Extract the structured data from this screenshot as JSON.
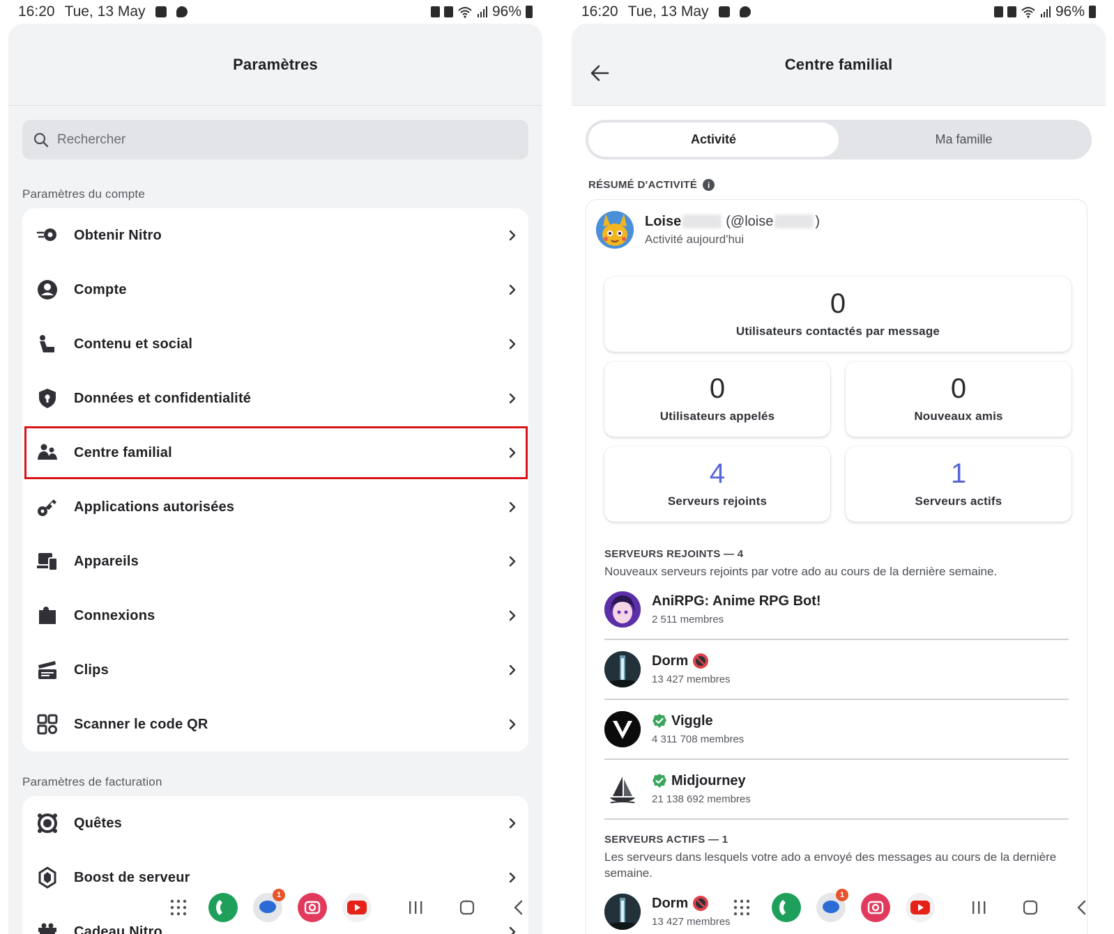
{
  "status_bar": {
    "time": "16:20",
    "date": "Tue, 13 May",
    "battery": "96%"
  },
  "left": {
    "title": "Paramètres",
    "search_placeholder": "Rechercher",
    "account_section_title": "Paramètres du compte",
    "account_items": [
      {
        "label": "Obtenir Nitro",
        "icon": "nitro-icon"
      },
      {
        "label": "Compte",
        "icon": "account-icon"
      },
      {
        "label": "Contenu et social",
        "icon": "content-social-icon"
      },
      {
        "label": "Données et confidentialité",
        "icon": "shield-icon"
      },
      {
        "label": "Centre familial",
        "icon": "family-icon",
        "highlighted": true
      },
      {
        "label": "Applications autorisées",
        "icon": "key-icon"
      },
      {
        "label": "Appareils",
        "icon": "devices-icon"
      },
      {
        "label": "Connexions",
        "icon": "puzzle-icon"
      },
      {
        "label": "Clips",
        "icon": "clapper-icon"
      },
      {
        "label": "Scanner le code QR",
        "icon": "qr-icon"
      }
    ],
    "billing_section_title": "Paramètres de facturation",
    "billing_items": [
      {
        "label": "Quêtes",
        "icon": "quests-icon"
      },
      {
        "label": "Boost de serveur",
        "icon": "boost-icon"
      },
      {
        "label": "Cadeau Nitro",
        "icon": "gift-icon"
      }
    ]
  },
  "right": {
    "title": "Centre familial",
    "tabs": [
      "Activité",
      "Ma famille"
    ],
    "activity_summary_title": "RÉSUMÉ D'ACTIVITÉ",
    "user": {
      "name_prefix": "Loise",
      "handle_prefix": "(@loise",
      "handle_suffix": ")",
      "subtitle": "Activité aujourd'hui"
    },
    "stats": {
      "messaged": {
        "value": "0",
        "label": "Utilisateurs contactés par message"
      },
      "called": {
        "value": "0",
        "label": "Utilisateurs appelés"
      },
      "new_friends": {
        "value": "0",
        "label": "Nouveaux amis"
      },
      "joined": {
        "value": "4",
        "label": "Serveurs rejoints"
      },
      "active": {
        "value": "1",
        "label": "Serveurs actifs"
      }
    },
    "joined_section": {
      "title": "SERVEURS REJOINTS — 4",
      "description": "Nouveaux serveurs rejoints par votre ado au cours de la dernière semaine.",
      "servers": [
        {
          "name": "AniRPG: Anime RPG Bot!",
          "members": "2 511 membres",
          "badge": ""
        },
        {
          "name": "Dorm",
          "members": "13 427 membres",
          "badge": "nsfw-icon"
        },
        {
          "name": "Viggle",
          "members": "4 311 708 membres",
          "badge": "verified-icon"
        },
        {
          "name": "Midjourney",
          "members": "21 138 692 membres",
          "badge": "verified-icon"
        }
      ]
    },
    "active_section": {
      "title": "SERVEURS ACTIFS — 1",
      "description": "Les serveurs dans lesquels votre ado a envoyé des messages au cours de la dernière semaine.",
      "servers": [
        {
          "name": "Dorm",
          "members": "13 427 membres",
          "badge": "nsfw-icon"
        }
      ]
    }
  },
  "nav": {
    "message_badge": "1"
  },
  "colors": {
    "accent": "#5865d6",
    "highlight": "#d81418",
    "verified": "#3ba55d"
  }
}
